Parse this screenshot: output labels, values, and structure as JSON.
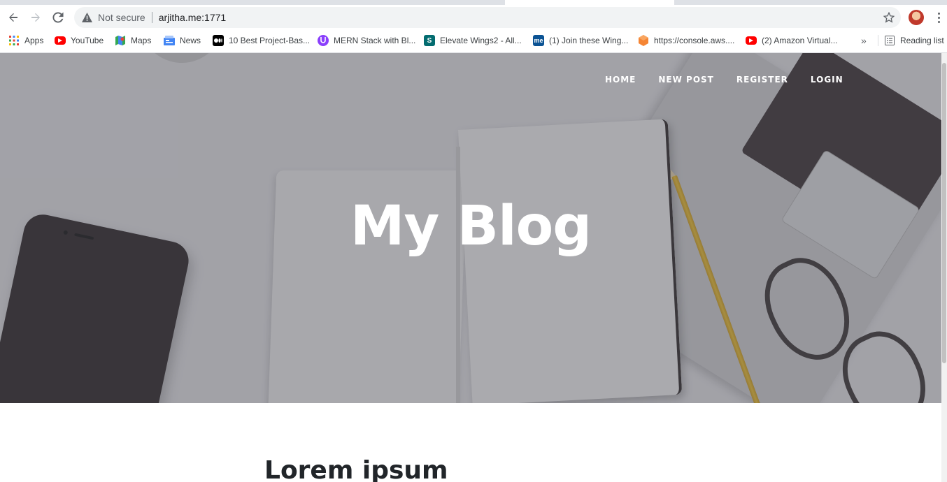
{
  "browser": {
    "security_label": "Not secure",
    "url": "arjitha.me:1771",
    "icons": {
      "back": "back-arrow-icon",
      "forward": "forward-arrow-icon",
      "reload": "reload-icon",
      "warning": "warning-icon",
      "bookmark_star": "star-icon",
      "profile": "profile-avatar",
      "menu": "kebab-menu-icon"
    }
  },
  "bookmarks": {
    "items": [
      {
        "label": "Apps",
        "icon": "apps-grid-icon"
      },
      {
        "label": "YouTube",
        "icon": "youtube-icon"
      },
      {
        "label": "Maps",
        "icon": "maps-icon"
      },
      {
        "label": "News",
        "icon": "news-icon"
      },
      {
        "label": "10 Best Project-Bas...",
        "icon": "medium-icon"
      },
      {
        "label": "MERN Stack with Bl...",
        "icon": "purple-logo-icon"
      },
      {
        "label": "Elevate Wings2 - All...",
        "icon": "sharepoint-icon"
      },
      {
        "label": "(1) Join these Wing...",
        "icon": "me-icon"
      },
      {
        "label": "https://console.aws....",
        "icon": "aws-icon"
      },
      {
        "label": "(2) Amazon Virtual...",
        "icon": "youtube-icon"
      }
    ],
    "overflow": "»",
    "reading_list": "Reading list"
  },
  "site": {
    "nav": [
      "HOME",
      "NEW POST",
      "REGISTER",
      "LOGIN"
    ],
    "hero_title": "My Blog",
    "post_title": "Lorem ipsum"
  },
  "colors": {
    "youtube": "#ff0000",
    "nav_text": "#ffffff",
    "heading_text": "#212529"
  }
}
